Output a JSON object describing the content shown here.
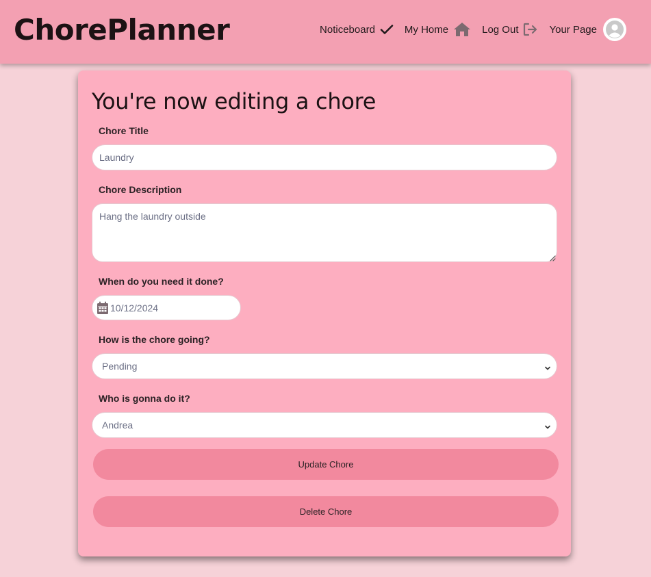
{
  "header": {
    "brand": "ChorePlanner",
    "nav": [
      {
        "label": "Noticeboard",
        "icon": "checkmark-icon"
      },
      {
        "label": "My Home",
        "icon": "home-icon"
      },
      {
        "label": "Log Out",
        "icon": "logout-icon"
      },
      {
        "label": "Your Page",
        "icon": "user-avatar-icon"
      }
    ]
  },
  "form": {
    "title": "You're now editing a chore",
    "chore_title": {
      "label": "Chore Title",
      "value": "Laundry"
    },
    "chore_description": {
      "label": "Chore Description",
      "value": "Hang the laundry outside"
    },
    "due_date": {
      "label": "When do you need it done?",
      "value": "10/12/2024"
    },
    "status": {
      "label": "How is the chore going?",
      "value": "Pending"
    },
    "assignee": {
      "label": "Who is gonna do it?",
      "value": "Andrea"
    },
    "update_button": "Update Chore",
    "delete_button": "Delete Chore"
  },
  "colors": {
    "page_bg": "#f6d2d8",
    "header_bg": "#f3a0b2",
    "card_bg": "#fdaec0",
    "button_bg": "#f2899e",
    "icon_gray": "#7c6a70"
  }
}
